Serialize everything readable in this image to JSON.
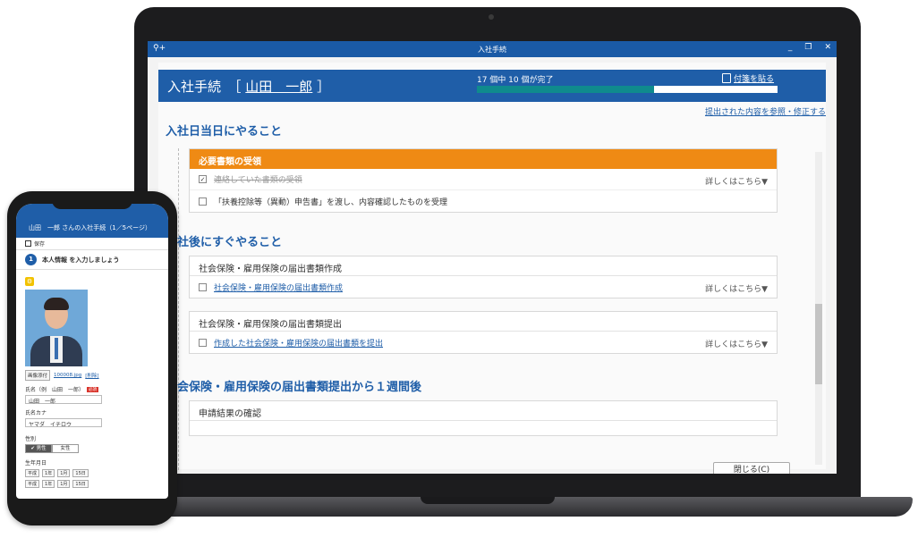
{
  "laptop": {
    "window_title": "入社手続",
    "header": {
      "title": "入社手続",
      "name": "山田　一郎",
      "progress_text": "17 個中 10 個が完了",
      "progress_fraction": 0.588,
      "sticky_label": "付箋を貼る"
    },
    "reference_link": "提出された内容を参照・修正する",
    "sections": [
      {
        "title": "入社日当日にやること"
      },
      {
        "title": "入社後にすぐやること"
      },
      {
        "title": "社会保険・雇用保険の届出書類提出から１週間後"
      }
    ],
    "cards": [
      {
        "heading": "必要書類の受領",
        "rows": [
          {
            "text": "連絡していた書類の受領",
            "checked": "✓",
            "detail": "詳しくはこちら▼"
          },
          {
            "text": "「扶養控除等（異動）申告書」を渡し、内容確認したものを受理",
            "checked": ""
          }
        ]
      },
      {
        "heading": "社会保険・雇用保険の届出書類作成",
        "rows": [
          {
            "text": "社会保険・雇用保険の届出書類作成",
            "detail": "詳しくはこちら▼"
          }
        ]
      },
      {
        "heading": "社会保険・雇用保険の届出書類提出",
        "rows": [
          {
            "text": "作成した社会保険・雇用保険の届出書類を提出",
            "detail": "詳しくはこちら▼"
          }
        ]
      },
      {
        "heading": "申請結果の確認"
      }
    ],
    "close_button": "閉じる(C)"
  },
  "phone": {
    "header": "山田　一郎 さんの入社手続（1／5ページ）",
    "save_label": "保存",
    "step_number": "1",
    "step_text": "本人情報 を入力しましょう",
    "attach_button": "画像添付",
    "file_name": "100008.jpg",
    "delete_label": "[削除]",
    "name_label": "氏名（例　山田　一郎）",
    "required_label": "必須",
    "name_value": "山田　一郎",
    "kana_label": "氏名カナ",
    "kana_value": "ヤマダ　イチロウ",
    "gender_label": "性別",
    "gender_male": "✔ 男性",
    "gender_female": "女性",
    "birth_label": "生年月日",
    "birth_era": "平成",
    "birth_year": "1年",
    "birth_month": "1月",
    "birth_day": "15日",
    "birth_era2": "平成",
    "birth_year2": "1年",
    "birth_month2": "1月",
    "birth_day2": "15日"
  }
}
